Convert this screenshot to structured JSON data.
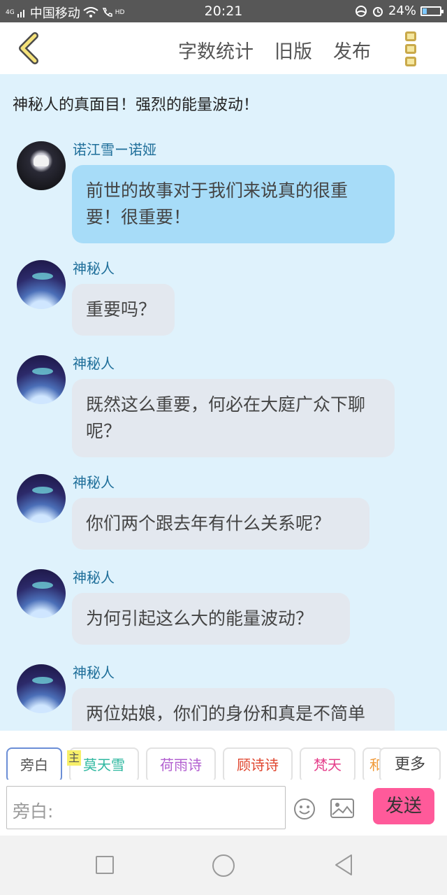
{
  "status_bar": {
    "signal": "4G",
    "carrier": "中国移动",
    "hd": "HD",
    "time": "20:21",
    "battery": "24%",
    "battery_level": 0.24
  },
  "topbar": {
    "actions": [
      "字数统计",
      "旧版",
      "发布"
    ]
  },
  "chat": {
    "title": "神秘人的真面目！强烈的能量波动！",
    "messages": [
      {
        "name": "诺江雪ー诺娅",
        "text": "前世的故事对于我们来说真的很重要！很重要！",
        "style": "blue"
      },
      {
        "name": "神秘人",
        "text": "重要吗？",
        "style": "grey"
      },
      {
        "name": "神秘人",
        "text": "既然这么重要，何必在大庭广众下聊呢？",
        "style": "grey"
      },
      {
        "name": "神秘人",
        "text": "你们两个跟去年有什么关系呢？",
        "style": "grey"
      },
      {
        "name": "神秘人",
        "text": "为何引起这么大的能量波动？",
        "style": "grey"
      },
      {
        "name": "神秘人",
        "text": "两位姑娘，你们的身份和真是不简单呢",
        "style": "grey"
      }
    ]
  },
  "roles": {
    "items": [
      {
        "label": "旁白",
        "color": "#555555"
      },
      {
        "label": "莫天雪",
        "color": "#2fb8a0"
      },
      {
        "label": "荷雨诗",
        "color": "#b25fd0"
      },
      {
        "label": "顾诗诗",
        "color": "#e0452e"
      },
      {
        "label": "梵天",
        "color": "#e53e8a"
      },
      {
        "label": "和",
        "color": "#f09a3a"
      }
    ],
    "main_tag": "主",
    "more": "更多"
  },
  "input": {
    "placeholder": "旁白:",
    "send": "发送"
  }
}
